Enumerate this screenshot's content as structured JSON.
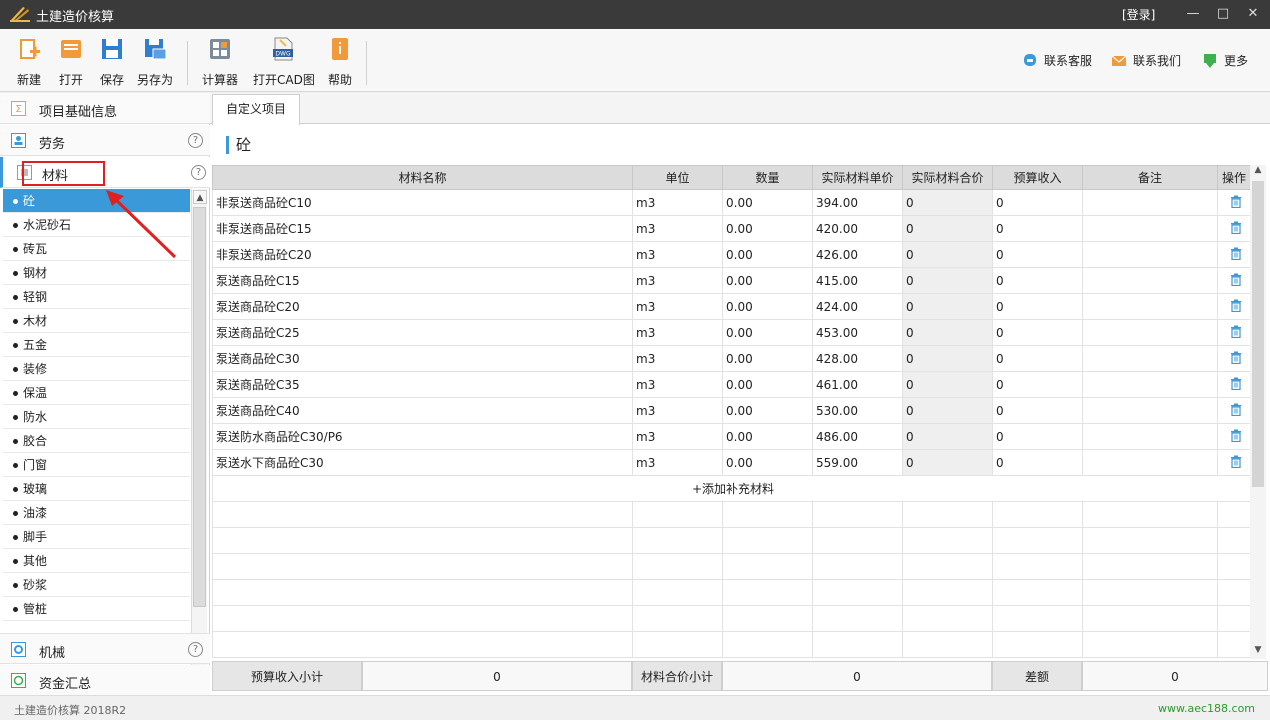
{
  "app": {
    "title": "土建造价核算",
    "login": "[登录]"
  },
  "toolbar": {
    "buttons": [
      {
        "label": "新建"
      },
      {
        "label": "打开"
      },
      {
        "label": "保存"
      },
      {
        "label": "另存为"
      },
      {
        "label": "计算器"
      },
      {
        "label": "打开CAD图"
      },
      {
        "label": "帮助"
      }
    ],
    "right": [
      {
        "label": "联系客服"
      },
      {
        "label": "联系我们"
      },
      {
        "label": "更多"
      }
    ]
  },
  "sidebar": {
    "sections": [
      {
        "label": "项目基础信息"
      },
      {
        "label": "劳务"
      },
      {
        "label": "材料"
      },
      {
        "label": "机械"
      },
      {
        "label": "资金汇总"
      }
    ],
    "materials": [
      "砼",
      "水泥砂石",
      "砖瓦",
      "钢材",
      "轻钢",
      "木材",
      "五金",
      "装修",
      "保温",
      "防水",
      "胶合",
      "门窗",
      "玻璃",
      "油漆",
      "脚手",
      "其他",
      "砂浆",
      "管桩"
    ],
    "selected": "砼"
  },
  "main": {
    "tab": "自定义项目",
    "section_title": "砼",
    "columns": [
      "材料名称",
      "单位",
      "数量",
      "实际材料单价",
      "实际材料合价",
      "预算收入",
      "备注",
      "操作"
    ],
    "rows": [
      {
        "name": "非泵送商品砼C10",
        "unit": "m3",
        "qty": "0.00",
        "price": "394.00",
        "total": "0",
        "budget": "0",
        "note": ""
      },
      {
        "name": "非泵送商品砼C15",
        "unit": "m3",
        "qty": "0.00",
        "price": "420.00",
        "total": "0",
        "budget": "0",
        "note": ""
      },
      {
        "name": "非泵送商品砼C20",
        "unit": "m3",
        "qty": "0.00",
        "price": "426.00",
        "total": "0",
        "budget": "0",
        "note": ""
      },
      {
        "name": "泵送商品砼C15",
        "unit": "m3",
        "qty": "0.00",
        "price": "415.00",
        "total": "0",
        "budget": "0",
        "note": ""
      },
      {
        "name": "泵送商品砼C20",
        "unit": "m3",
        "qty": "0.00",
        "price": "424.00",
        "total": "0",
        "budget": "0",
        "note": ""
      },
      {
        "name": "泵送商品砼C25",
        "unit": "m3",
        "qty": "0.00",
        "price": "453.00",
        "total": "0",
        "budget": "0",
        "note": ""
      },
      {
        "name": "泵送商品砼C30",
        "unit": "m3",
        "qty": "0.00",
        "price": "428.00",
        "total": "0",
        "budget": "0",
        "note": ""
      },
      {
        "name": "泵送商品砼C35",
        "unit": "m3",
        "qty": "0.00",
        "price": "461.00",
        "total": "0",
        "budget": "0",
        "note": ""
      },
      {
        "name": "泵送商品砼C40",
        "unit": "m3",
        "qty": "0.00",
        "price": "530.00",
        "total": "0",
        "budget": "0",
        "note": ""
      },
      {
        "name": "泵送防水商品砼C30/P6",
        "unit": "m3",
        "qty": "0.00",
        "price": "486.00",
        "total": "0",
        "budget": "0",
        "note": ""
      },
      {
        "name": "泵送水下商品砼C30",
        "unit": "m3",
        "qty": "0.00",
        "price": "559.00",
        "total": "0",
        "budget": "0",
        "note": ""
      }
    ],
    "add_label": "+添加补充材料",
    "footer": {
      "budget_label": "预算收入小计",
      "budget_value": "0",
      "material_label": "材料合价小计",
      "material_value": "0",
      "diff_label": "差额",
      "diff_value": "0"
    }
  },
  "status": {
    "version": "土建造价核算 2018R2",
    "url": "www.aec188.com"
  },
  "colors": {
    "accent": "#3a9ad9",
    "annotation": "#e02020"
  }
}
